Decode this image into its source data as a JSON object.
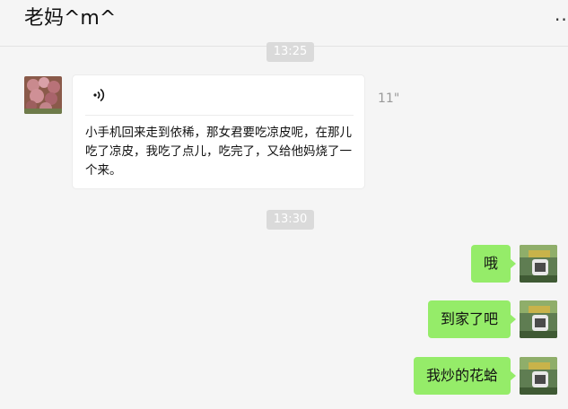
{
  "header": {
    "title": "老妈^m^",
    "more": "··"
  },
  "timestamps": [
    "13:25",
    "13:30"
  ],
  "contact": {
    "avatar": "contact-avatar"
  },
  "voice_message": {
    "icon": "voice-wave-icon",
    "transcript": "小手机回来走到依稀，那女君要吃凉皮呢，在那儿吃了凉皮，我吃了点儿，吃完了，又给他妈烧了一个来。",
    "duration": "11\""
  },
  "outgoing": [
    {
      "text": "哦"
    },
    {
      "text": "到家了吧"
    },
    {
      "text": "我炒的花蛤"
    }
  ],
  "colors": {
    "background": "#f5f5f5",
    "outgoing_bubble": "#95ec69",
    "incoming_bubble": "#ffffff",
    "timestamp_bg": "#dadada"
  }
}
